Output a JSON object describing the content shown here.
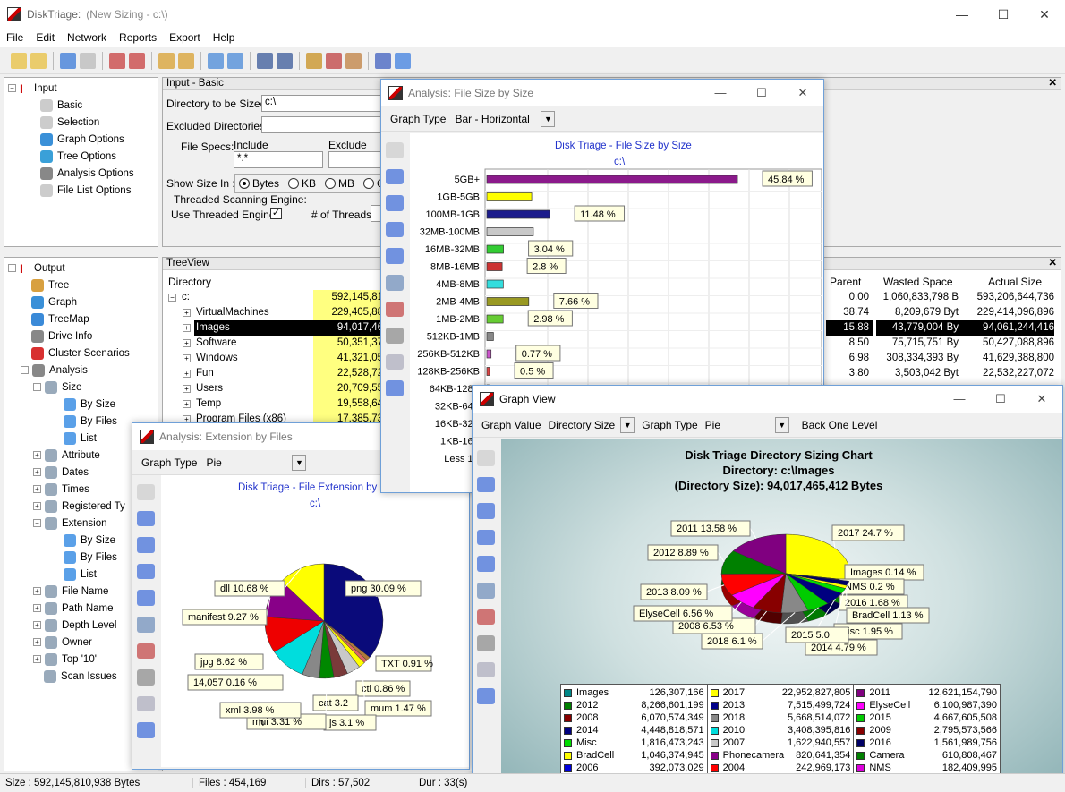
{
  "app": {
    "name": "DiskTriage:",
    "subtitle": "(New Sizing - c:\\)"
  },
  "window_controls": {
    "min": "—",
    "max": "☐",
    "close": "✕"
  },
  "menu": [
    "File",
    "Edit",
    "Network",
    "Reports",
    "Export",
    "Help"
  ],
  "input_tree": {
    "root": "Input",
    "items": [
      "Basic",
      "Selection",
      "Graph Options",
      "Tree Options",
      "Analysis Options",
      "File List Options"
    ]
  },
  "input_panel": {
    "title": "Input - Basic",
    "dir_label": "Directory to be Sized:",
    "dir_value": "c:\\",
    "excl_label": "Excluded Directories:",
    "filespecs_label": "File Specs:",
    "include_label": "Include",
    "include_value": "*.*",
    "exclude_label": "Exclude",
    "showsize_label": "Show Size In :",
    "size_options": [
      "Bytes",
      "KB",
      "MB",
      "GB"
    ],
    "threaded_label": "Threaded Scanning Engine:",
    "use_threaded": "Use Threaded Engine",
    "threads_label": "# of Threads"
  },
  "output_tree": {
    "root": "Output",
    "items": [
      {
        "label": "Tree",
        "level": 1
      },
      {
        "label": "Graph",
        "level": 1
      },
      {
        "label": "TreeMap",
        "level": 1
      },
      {
        "label": "Drive Info",
        "level": 1
      },
      {
        "label": "Cluster Scenarios",
        "level": 1
      },
      {
        "label": "Analysis",
        "level": 1,
        "exp": "−"
      },
      {
        "label": "Size",
        "level": 2,
        "exp": "−"
      },
      {
        "label": "By Size",
        "level": 3
      },
      {
        "label": "By Files",
        "level": 3
      },
      {
        "label": "List",
        "level": 3
      },
      {
        "label": "Attribute",
        "level": 2,
        "exp": "+"
      },
      {
        "label": "Dates",
        "level": 2,
        "exp": "+"
      },
      {
        "label": "Times",
        "level": 2,
        "exp": "+"
      },
      {
        "label": "Registered Ty",
        "level": 2,
        "exp": "+"
      },
      {
        "label": "Extension",
        "level": 2,
        "exp": "−"
      },
      {
        "label": "By Size",
        "level": 3
      },
      {
        "label": "By Files",
        "level": 3
      },
      {
        "label": "List",
        "level": 3
      },
      {
        "label": "File Name",
        "level": 2,
        "exp": "+"
      },
      {
        "label": "Path Name",
        "level": 2,
        "exp": "+"
      },
      {
        "label": "Depth Level",
        "level": 2,
        "exp": "+"
      },
      {
        "label": "Owner",
        "level": 2,
        "exp": "+"
      },
      {
        "label": "Top '10'",
        "level": 2,
        "exp": "+"
      },
      {
        "label": "Scan Issues",
        "level": 2
      }
    ]
  },
  "treeview": {
    "title": "TreeView",
    "col_directory": "Directory",
    "col_parent": "Parent",
    "col_wasted": "Wasted Space",
    "col_actual": "Actual Size",
    "rows": [
      {
        "name": "c:",
        "size": "592,145,81",
        "parent": "0.00",
        "wasted": "1,060,833,798 B",
        "actual": "593,206,644,736"
      },
      {
        "name": "VirtualMachines",
        "size": "229,405,88",
        "parent": "38.74",
        "wasted": "8,209,679 Byt",
        "actual": "229,414,096,896"
      },
      {
        "name": "Images",
        "size": "94,017,46",
        "parent": "15.88",
        "wasted": "43,779,004 By",
        "actual": "94,061,244,416"
      },
      {
        "name": "Software",
        "size": "50,351,37",
        "parent": "8.50",
        "wasted": "75,715,751 By",
        "actual": "50,427,088,896"
      },
      {
        "name": "Windows",
        "size": "41,321,05",
        "parent": "6.98",
        "wasted": "308,334,393 By",
        "actual": "41,629,388,800"
      },
      {
        "name": "Fun",
        "size": "22,528,72",
        "parent": "3.80",
        "wasted": "3,503,042 Byt",
        "actual": "22,532,227,072"
      },
      {
        "name": "Users",
        "size": "20,709,55",
        "parent": "",
        "wasted": "",
        "actual": ""
      },
      {
        "name": "Temp",
        "size": "19,558,64",
        "parent": "",
        "wasted": "",
        "actual": ""
      },
      {
        "name": "Program Files (x86)",
        "size": "17,385,73",
        "parent": "",
        "wasted": "",
        "actual": ""
      }
    ]
  },
  "win_filesize": {
    "title": "Analysis: File Size by Size",
    "graph_type_label": "Graph Type",
    "graph_type_value": "Bar - Horizontal",
    "chart_title": "Disk Triage - File Size by Size",
    "chart_subtitle": "c:\\"
  },
  "win_extension": {
    "title": "Analysis: Extension by Files",
    "graph_type_label": "Graph Type",
    "graph_type_value": "Pie",
    "chart_title": "Disk Triage - File Extension by F",
    "chart_subtitle": "c:\\"
  },
  "win_graphview": {
    "title": "Graph View",
    "graph_value_label": "Graph Value",
    "graph_value": "Directory Size",
    "graph_type_label": "Graph Type",
    "graph_type_value": "Pie",
    "back_label": "Back One Level",
    "chart_title": "Disk Triage Directory Sizing Chart",
    "chart_line2": "Directory: c:\\Images",
    "chart_line3": "(Directory Size): 94,017,465,412 Bytes"
  },
  "chart_data": [
    {
      "type": "bar",
      "orientation": "horizontal",
      "title": "Disk Triage - File Size by Size",
      "subtitle": "c:\\",
      "categories": [
        "5GB+",
        "1GB-5GB",
        "100MB-1GB",
        "32MB-100MB",
        "16MB-32MB",
        "8MB-16MB",
        "4MB-8MB",
        "2MB-4MB",
        "1MB-2MB",
        "512KB-1MB",
        "256KB-512KB",
        "128KB-256KB",
        "64KB-128K",
        "32KB-64K",
        "16KB-32K",
        "1KB-16K",
        "Less 1K"
      ],
      "values": [
        45.84,
        8.2,
        11.48,
        8.5,
        3.04,
        2.8,
        3.0,
        7.66,
        2.98,
        1.2,
        0.77,
        0.5,
        0.4,
        0.3,
        0.2,
        0.1,
        0.05
      ],
      "colors": [
        "#8b1a8b",
        "#ffff00",
        "#1c1c8c",
        "#c8c8c8",
        "#33cc33",
        "#cc3333",
        "#33dddd",
        "#999922",
        "#66cc33",
        "#888888",
        "#cc55cc",
        "#dd4444",
        "#777777",
        "#777777",
        "#777777",
        "#777777",
        "#777777"
      ],
      "data_labels": {
        "0": "45.84 %",
        "2": "11.48 %",
        "4": "3.04 %",
        "5": "2.8 %",
        "7": "7.66 %",
        "8": "2.98 %",
        "10": "0.77 %",
        "11": "0.5 %"
      }
    },
    {
      "type": "pie",
      "title": "Disk Triage - File Extension by F",
      "subtitle": "c:\\",
      "slices": [
        {
          "label": "png 30.09 %",
          "value": 30.09,
          "color": "#0a0a7a"
        },
        {
          "label": "TXT 0.91 %",
          "value": 0.91,
          "color": "#b07a3a"
        },
        {
          "label": "ctl 0.86 %",
          "value": 0.86,
          "color": "#dd6666"
        },
        {
          "label": "mum 1.47 %",
          "value": 1.47,
          "color": "#ffff00"
        },
        {
          "label": "js 3.1 %",
          "value": 3.1,
          "color": "#c8c8c8"
        },
        {
          "label": "cat 3.2",
          "value": 3.2,
          "color": "#7a3a3a"
        },
        {
          "label": "mui 3.31 %",
          "value": 3.31,
          "color": "#008800"
        },
        {
          "label": "xml 3.98 %",
          "value": 3.98,
          "color": "#888888"
        },
        {
          "label": "14,057 0.16 %",
          "value": 8.3,
          "color": "#00dddd"
        },
        {
          "label": "jpg 8.62 %",
          "value": 8.62,
          "color": "#ee0000"
        },
        {
          "label": "manifest 9.27 %",
          "value": 9.27,
          "color": "#880088"
        },
        {
          "label": "dll 10.68 %",
          "value": 10.68,
          "color": "#ffff00"
        }
      ],
      "extra_labels": [
        "h"
      ]
    },
    {
      "type": "pie",
      "title": "Disk Triage Directory Sizing Chart",
      "slices": [
        {
          "label": "2017 24.7 %",
          "value": 24.7,
          "color": "#ffff00"
        },
        {
          "label": "Images 0.14 %",
          "value": 0.14,
          "color": "#008888"
        },
        {
          "label": "NMS 0.2 %",
          "value": 0.2,
          "color": "#dd00dd"
        },
        {
          "label": "2016 1.68 %",
          "value": 1.68,
          "color": "#000066"
        },
        {
          "label": "BradCell 1.13 %",
          "value": 1.13,
          "color": "#ffff00"
        },
        {
          "label": "Misc 1.95 %",
          "value": 1.95,
          "color": "#00dd00"
        },
        {
          "label": "2014 4.79 %",
          "value": 4.79,
          "color": "#000080"
        },
        {
          "label": "2015 5.0",
          "value": 5.02,
          "color": "#00cc00"
        },
        {
          "label": "2018 6.1 %",
          "value": 6.1,
          "color": "#888888"
        },
        {
          "label": "2008 6.53 %",
          "value": 6.53,
          "color": "#880000"
        },
        {
          "label": "ElyseCell 6.56 %",
          "value": 6.56,
          "color": "#ff00ff"
        },
        {
          "label": "2013 8.09 %",
          "value": 8.09,
          "color": "#ff0000"
        },
        {
          "label": "2012 8.89 %",
          "value": 8.89,
          "color": "#008000"
        },
        {
          "label": "2011 13.58 %",
          "value": 13.58,
          "color": "#800080"
        }
      ],
      "legend": [
        [
          {
            "name": "Images",
            "value": "126,307,166",
            "color": "#008888"
          },
          {
            "name": "2012",
            "value": "8,266,601,199",
            "color": "#008000"
          },
          {
            "name": "2008",
            "value": "6,070,574,349",
            "color": "#880000"
          },
          {
            "name": "2014",
            "value": "4,448,818,571",
            "color": "#000080"
          },
          {
            "name": "Misc",
            "value": "1,816,473,243",
            "color": "#00dd00"
          },
          {
            "name": "BradCell",
            "value": "1,046,374,945",
            "color": "#ffff00"
          },
          {
            "name": "2006",
            "value": "392,073,029",
            "color": "#0000dd"
          }
        ],
        [
          {
            "name": "2017",
            "value": "22,952,827,805",
            "color": "#ffff00"
          },
          {
            "name": "2013",
            "value": "7,515,499,724",
            "color": "#000088"
          },
          {
            "name": "2018",
            "value": "5,668,514,072",
            "color": "#888888"
          },
          {
            "name": "2010",
            "value": "3,408,395,816",
            "color": "#00dddd"
          },
          {
            "name": "2007",
            "value": "1,622,940,557",
            "color": "#c8c8c8"
          },
          {
            "name": "Phonecamera",
            "value": "820,641,354",
            "color": "#880088"
          },
          {
            "name": "2004",
            "value": "242,969,173",
            "color": "#ff0000"
          }
        ],
        [
          {
            "name": "2011",
            "value": "12,621,154,790",
            "color": "#800080"
          },
          {
            "name": "ElyseCell",
            "value": "6,100,987,390",
            "color": "#ff00ff"
          },
          {
            "name": "2015",
            "value": "4,667,605,508",
            "color": "#00cc00"
          },
          {
            "name": "2009",
            "value": "2,795,573,566",
            "color": "#880000"
          },
          {
            "name": "2016",
            "value": "1,561,989,756",
            "color": "#000066"
          },
          {
            "name": "Camera",
            "value": "610,808,467",
            "color": "#008000"
          },
          {
            "name": "NMS",
            "value": "182,409,995",
            "color": "#dd00dd"
          }
        ]
      ]
    }
  ],
  "status": {
    "size": "Size :  592,145,810,938  Bytes",
    "files": "Files :  454,169",
    "dirs": "Dirs :  57,502",
    "dur": "Dur : 33(s)"
  }
}
